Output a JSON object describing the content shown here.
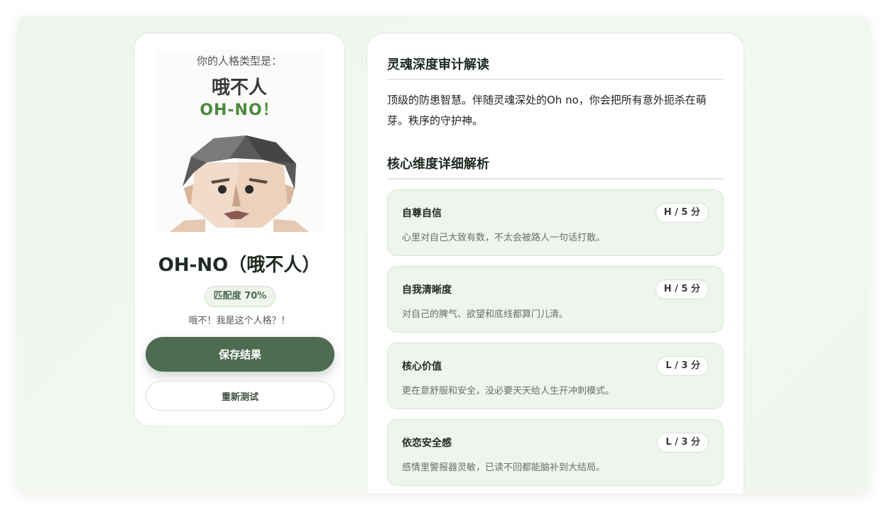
{
  "result": {
    "poster_label": "你的人格类型是：",
    "poster_cn": "哦不人",
    "poster_en": "OH-NO！",
    "type_name": "OH-NO（哦不人）",
    "match": "匹配度 70%",
    "tagline": "哦不！我是这个人格？！",
    "save_label": "保存结果",
    "retest_label": "重新测试"
  },
  "analysis": {
    "soul_title": "灵魂深度审计解读",
    "soul_text": "顶级的防患智慧。伴随灵魂深处的Oh no，你会把所有意外扼杀在萌芽。秩序的守护神。",
    "dims_title": "核心维度详细解析",
    "dimensions": [
      {
        "name": "自尊自信",
        "score": "H / 5 分",
        "desc": "心里对自己大致有数，不太会被路人一句话打散。"
      },
      {
        "name": "自我清晰度",
        "score": "H / 5 分",
        "desc": "对自己的脾气、欲望和底线都算门儿清。"
      },
      {
        "name": "核心价值",
        "score": "L / 3 分",
        "desc": "更在意舒服和安全，没必要天天给人生开冲刺模式。"
      },
      {
        "name": "依恋安全感",
        "score": "L / 3 分",
        "desc": "感情里警报器灵敏，已读不回都能脑补到大结局。"
      }
    ]
  },
  "colors": {
    "accent": "#4f6b52",
    "brand_green": "#4a8a3c",
    "card_tint": "#eef5ec"
  },
  "icons": [
    "avatar-illustration"
  ]
}
